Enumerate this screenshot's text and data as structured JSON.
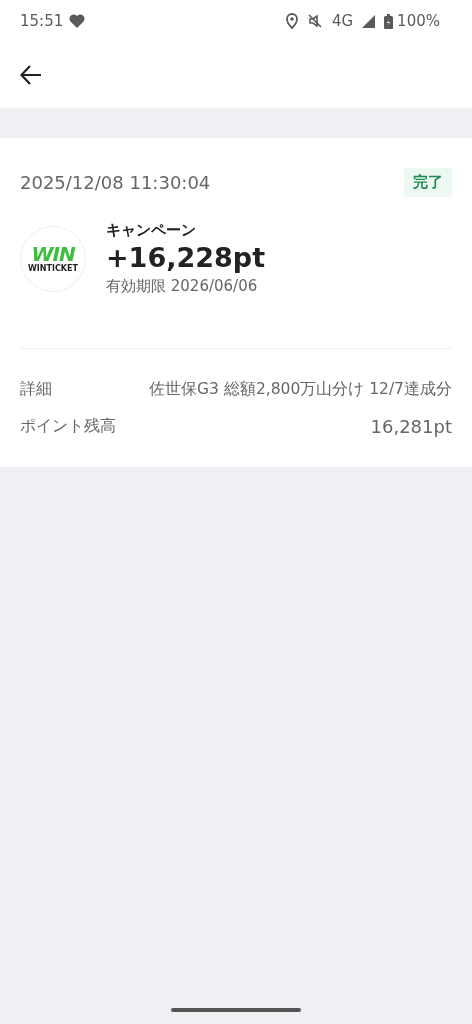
{
  "status_bar": {
    "time": "15:51",
    "network": "4G",
    "battery": "100%"
  },
  "transaction": {
    "datetime": "2025/12/08 11:30:04",
    "status": "完了",
    "logo": {
      "mark": "WIN",
      "name": "WINTICKET"
    },
    "category": "キャンペーン",
    "amount": "+16,228pt",
    "expiry": "有効期限 2026/06/06"
  },
  "details": [
    {
      "label": "詳細",
      "value": "佐世保G3 総額2,800万山分け 12/7達成分"
    },
    {
      "label": "ポイント残高",
      "value": "16,281pt"
    }
  ]
}
